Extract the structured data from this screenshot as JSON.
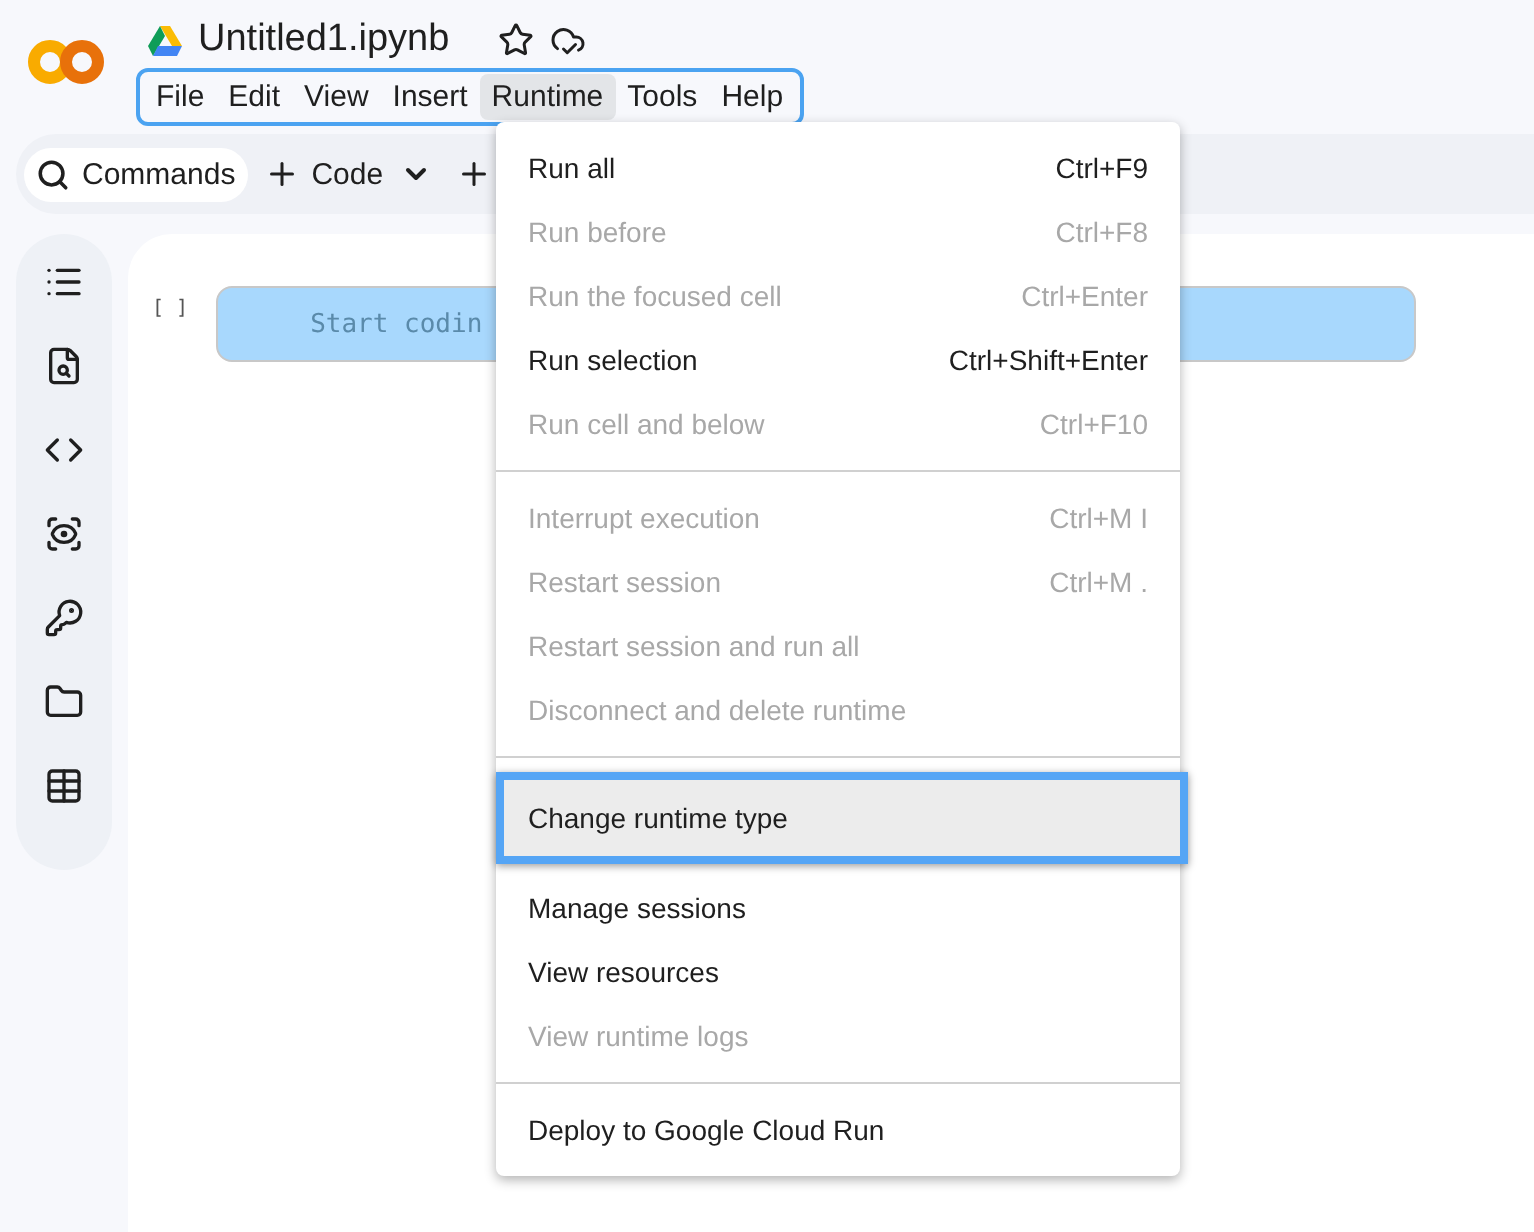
{
  "notebook": {
    "title": "Untitled1.ipynb",
    "starred": false
  },
  "menubar": [
    {
      "label": "File",
      "selected": false
    },
    {
      "label": "Edit",
      "selected": false
    },
    {
      "label": "View",
      "selected": false
    },
    {
      "label": "Insert",
      "selected": false
    },
    {
      "label": "Runtime",
      "selected": true
    },
    {
      "label": "Tools",
      "selected": false
    },
    {
      "label": "Help",
      "selected": false
    }
  ],
  "toolbar": {
    "commands": "Commands",
    "code": "Code"
  },
  "cell": {
    "run_label": "[ ]",
    "placeholder": "Start codin"
  },
  "runtime_menu": {
    "sections": [
      {
        "items": [
          {
            "label": "Run all",
            "shortcut": "Ctrl+F9",
            "disabled": false,
            "selected": false
          },
          {
            "label": "Run before",
            "shortcut": "Ctrl+F8",
            "disabled": true,
            "selected": false
          },
          {
            "label": "Run the focused cell",
            "shortcut": "Ctrl+Enter",
            "disabled": true,
            "selected": false
          },
          {
            "label": "Run selection",
            "shortcut": "Ctrl+Shift+Enter",
            "disabled": false,
            "selected": false
          },
          {
            "label": "Run cell and below",
            "shortcut": "Ctrl+F10",
            "disabled": true,
            "selected": false
          }
        ]
      },
      {
        "items": [
          {
            "label": "Interrupt execution",
            "shortcut": "Ctrl+M I",
            "disabled": true,
            "selected": false
          },
          {
            "label": "Restart session",
            "shortcut": "Ctrl+M .",
            "disabled": true,
            "selected": false
          },
          {
            "label": "Restart session and run all",
            "disabled": true,
            "selected": false
          },
          {
            "label": "Disconnect and delete runtime",
            "disabled": true,
            "selected": false
          }
        ]
      },
      {
        "items": [
          {
            "label": "Change runtime type",
            "disabled": false,
            "selected": true
          },
          {
            "label": "Manage sessions",
            "disabled": false,
            "selected": false
          },
          {
            "label": "View resources",
            "disabled": false,
            "selected": false
          },
          {
            "label": "View runtime logs",
            "disabled": true,
            "selected": false
          }
        ]
      },
      {
        "items": [
          {
            "label": "Deploy to Google Cloud Run",
            "disabled": false,
            "selected": false
          }
        ]
      }
    ]
  }
}
